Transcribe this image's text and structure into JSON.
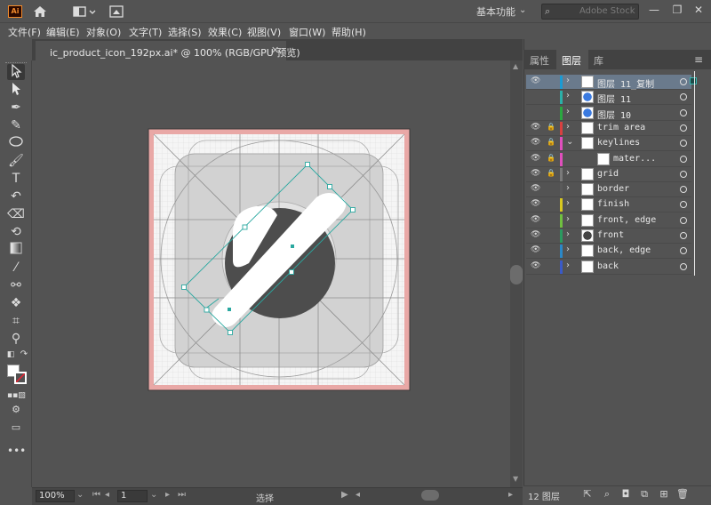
{
  "app": {
    "logo_text": "Ai"
  },
  "titlebar": {
    "workspace_label": "基本功能",
    "search_placeholder": "Adobe Stock",
    "minimize": "—",
    "restore": "❐",
    "close": "✕"
  },
  "menu": {
    "items": [
      "文件(F)",
      "编辑(E)",
      "对象(O)",
      "文字(T)",
      "选择(S)",
      "效果(C)",
      "视图(V)",
      "窗口(W)",
      "帮助(H)"
    ]
  },
  "document": {
    "tab_title": "ic_product_icon_192px.ai* @ 100% (RGB/GPU 预览)",
    "close_glyph": "✕"
  },
  "statusbar": {
    "zoom": "100%",
    "page": "1",
    "status_text": "选择"
  },
  "panel": {
    "tabs": [
      "属性",
      "图层",
      "库"
    ],
    "active_tab": "图层",
    "layer_count": "12 图层",
    "layers": [
      {
        "name": "图层 11_复制",
        "visible": true,
        "locked": false,
        "color": "#1a9bd4",
        "selected": true,
        "thumb": "white"
      },
      {
        "name": "图层 11",
        "visible": false,
        "locked": false,
        "color": "#2bb0a8",
        "selected": false,
        "thumb": "blue"
      },
      {
        "name": "图层 10",
        "visible": false,
        "locked": false,
        "color": "#2aa840",
        "selected": false,
        "thumb": "blue"
      },
      {
        "name": "trim area",
        "visible": true,
        "locked": true,
        "color": "#d84040",
        "selected": false,
        "thumb": "white"
      },
      {
        "name": "keylines",
        "visible": true,
        "locked": true,
        "color": "#e04fbd",
        "selected": false,
        "thumb": "white",
        "expanded": true
      },
      {
        "name": "mater...",
        "visible": true,
        "locked": true,
        "color": "#e04fbd",
        "selected": false,
        "thumb": "white",
        "child": true
      },
      {
        "name": "grid",
        "visible": true,
        "locked": true,
        "color": "#7a7a7a",
        "selected": false,
        "thumb": "white"
      },
      {
        "name": "border",
        "visible": true,
        "locked": false,
        "color": "#5a5a5a",
        "selected": false,
        "thumb": "white"
      },
      {
        "name": "finish",
        "visible": true,
        "locked": false,
        "color": "#d8c820",
        "selected": false,
        "thumb": "white"
      },
      {
        "name": "front, edge",
        "visible": true,
        "locked": false,
        "color": "#70c040",
        "selected": false,
        "thumb": "white"
      },
      {
        "name": "front",
        "visible": true,
        "locked": false,
        "color": "#2a9a60",
        "selected": false,
        "thumb": "dark"
      },
      {
        "name": "back, edge",
        "visible": true,
        "locked": false,
        "color": "#2a88c8",
        "selected": false,
        "thumb": "white"
      },
      {
        "name": "back",
        "visible": true,
        "locked": false,
        "color": "#3a5ac8",
        "selected": false,
        "thumb": "white"
      }
    ]
  },
  "colors": {
    "selection": "#2aa8a0",
    "trim": "#e8a0a0",
    "artboard": "#f4f4f4"
  }
}
